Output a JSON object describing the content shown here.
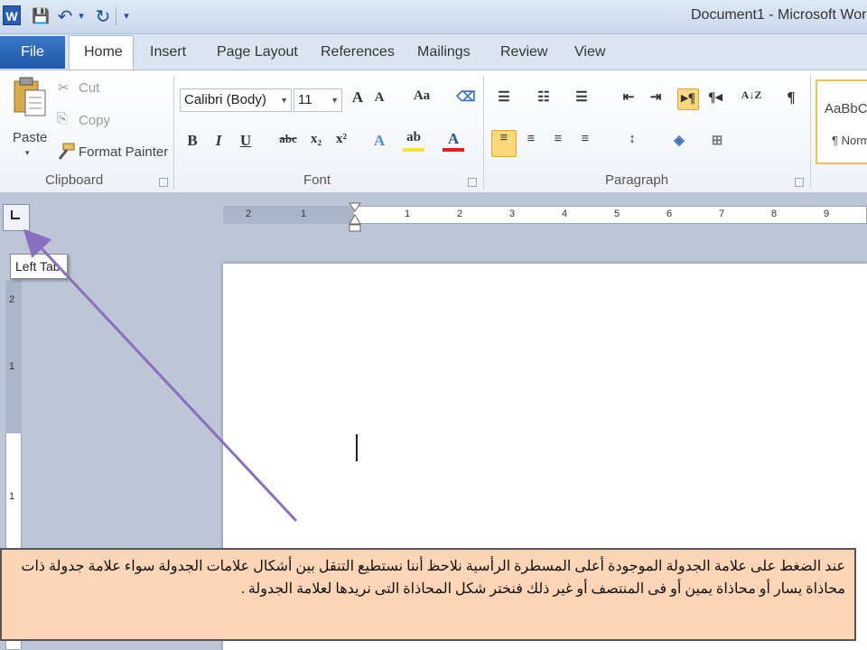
{
  "titlebar": {
    "app_icon": "W",
    "title": "Document1 - Microsoft Wor",
    "quick_access": [
      {
        "icon": "save-icon",
        "glyph": "💾"
      },
      {
        "icon": "undo-icon",
        "glyph": "↶"
      },
      {
        "icon": "dropdown-icon",
        "glyph": "▾"
      },
      {
        "icon": "redo-icon",
        "glyph": "↻"
      },
      {
        "icon": "customize-icon",
        "glyph": "▾"
      }
    ]
  },
  "tabs": {
    "file": "File",
    "items": [
      "Home",
      "Insert",
      "Page Layout",
      "References",
      "Mailings",
      "Review",
      "View"
    ],
    "active": "Home"
  },
  "ribbon": {
    "clipboard": {
      "label": "Clipboard",
      "paste": "Paste",
      "cut": "Cut",
      "copy": "Copy",
      "format_painter": "Format Painter"
    },
    "font": {
      "label": "Font",
      "font_name": "Calibri (Body)",
      "font_size": "11",
      "grow": "A",
      "shrink": "A",
      "change_case": "Aa",
      "bold": "B",
      "italic": "I",
      "underline": "U",
      "strikethrough": "abc",
      "subscript": "x₂",
      "superscript": "x²",
      "text_effects": "A",
      "highlight": "ab",
      "font_color": "A"
    },
    "paragraph": {
      "label": "Paragraph",
      "pilcrow": "¶",
      "sort": "A↓Z"
    },
    "styles": {
      "sample": "AaBbC",
      "normal": "¶ Norm"
    }
  },
  "ruler": {
    "horizontal_numbers": [
      "2",
      "1",
      "1",
      "2",
      "3",
      "4",
      "5",
      "6",
      "7",
      "8",
      "9"
    ],
    "vertical_numbers": [
      "2",
      "1",
      "1"
    ]
  },
  "tooltip": "Left Tab",
  "annotation": "عند الضغط على علامة الجدولة الموجودة أعلى المسطرة الرأسية نلاحظ أننا نستطيع التنقل بين أشكال علامات الجدولة سواء علامة جدولة ذات محاذاة يسار أو محاذاة يمين أو فى المنتصف أو غير ذلك فنختر شكل المحاذاة التى نريدها لعلامة الجدولة .",
  "colors": {
    "arrow": "#8a6fc0",
    "annotation_bg": "#fbd5b5",
    "file_tab": "#2a65b8",
    "active_button": "#fbd97a"
  }
}
